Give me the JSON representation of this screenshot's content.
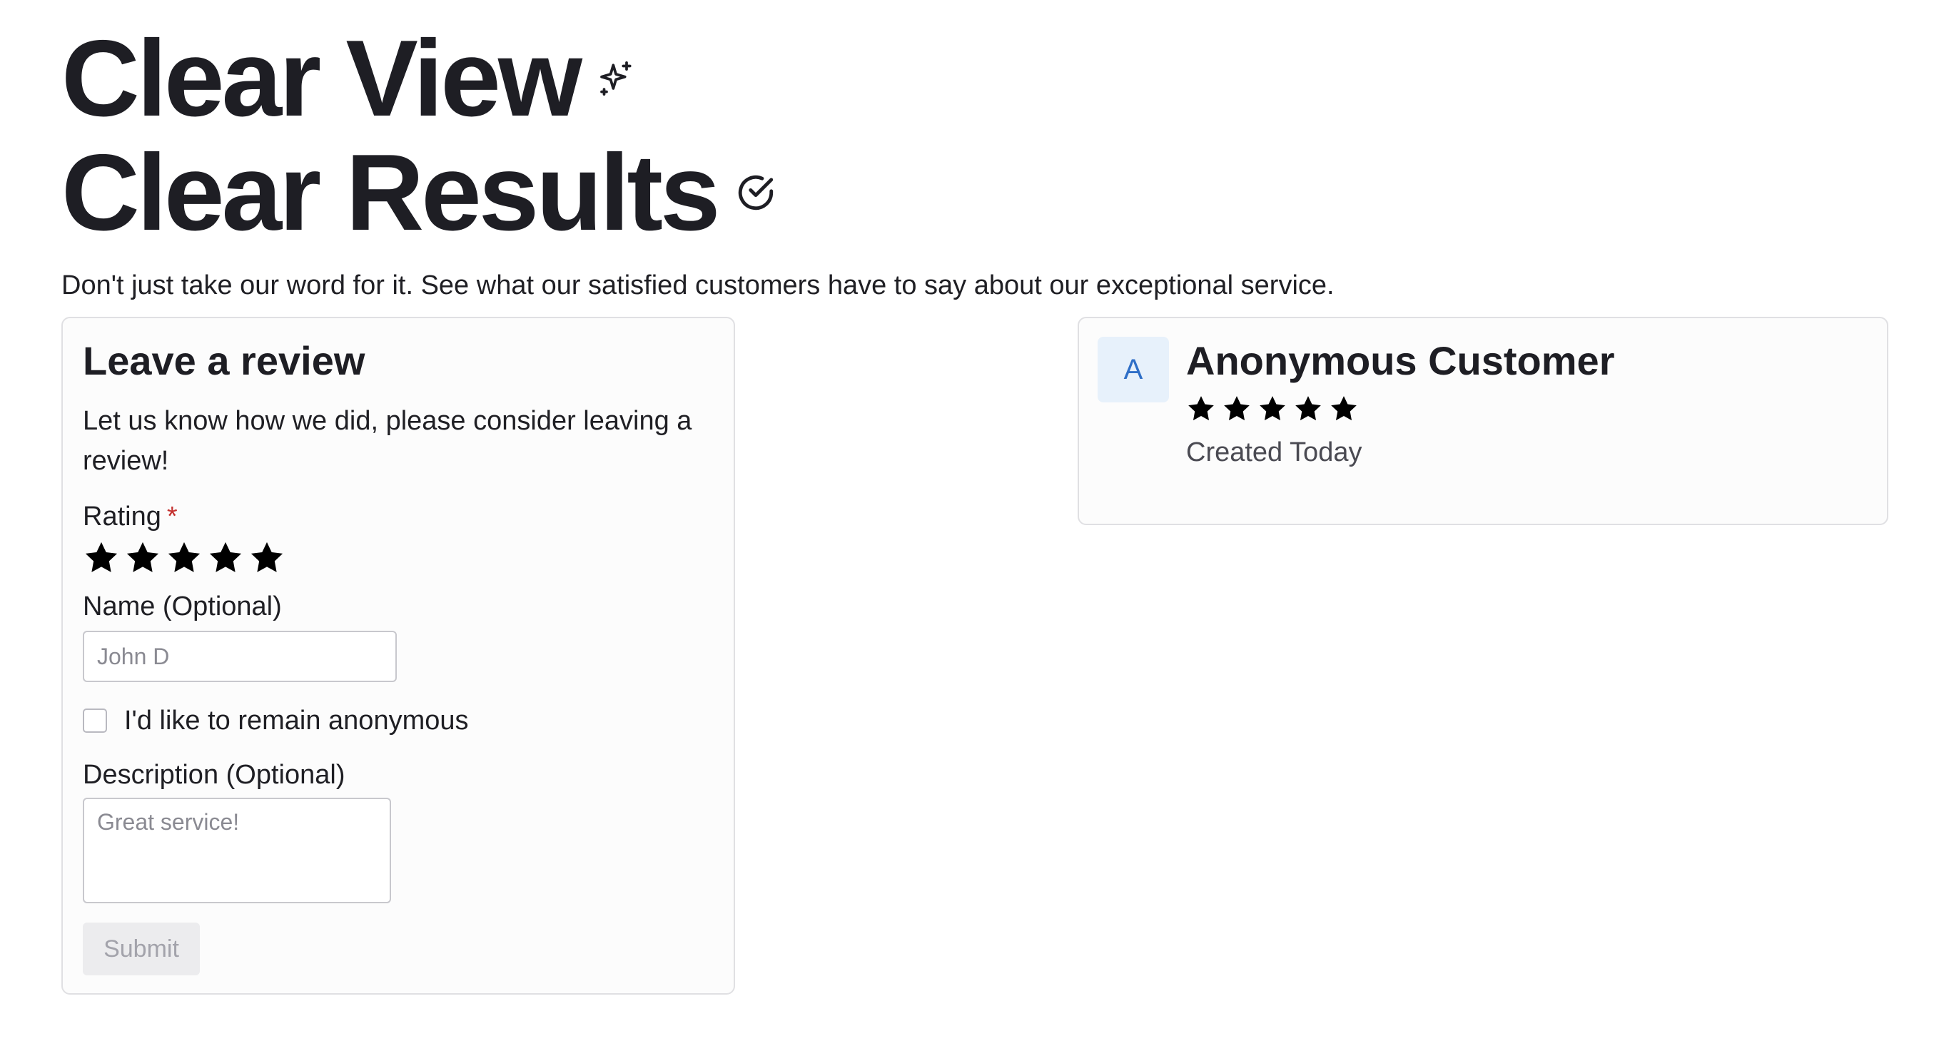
{
  "hero": {
    "line1": "Clear View",
    "line1_icon": "sparkles-icon",
    "line2": "Clear Results",
    "line2_icon": "check-circle-icon",
    "subtitle": "Don't just take our word for it. See what our satisfied customers have to say about our exceptional service."
  },
  "form": {
    "title": "Leave a review",
    "description": "Let us know how we did, please consider leaving a review!",
    "rating_label": "Rating",
    "required_mark": "*",
    "rating_value": 5,
    "rating_max": 5,
    "name_label": "Name (Optional)",
    "name_placeholder": "John D",
    "name_value": "",
    "anonymous_label": "I'd like to remain anonymous",
    "anonymous_checked": false,
    "description_label": "Description (Optional)",
    "description_placeholder": "Great service!",
    "submit_label": "Submit",
    "submit_disabled": true
  },
  "review": {
    "avatar_initial": "A",
    "name": "Anonymous Customer",
    "rating": 5,
    "date": "Created Today"
  },
  "colors": {
    "text": "#1e1e24",
    "required": "#c4312f",
    "avatar_bg": "#e7f1fb",
    "avatar_text": "#2f6fc7",
    "card_border": "#e0e0e3",
    "submit_bg": "#ececee",
    "submit_text": "#a3a3ab"
  }
}
